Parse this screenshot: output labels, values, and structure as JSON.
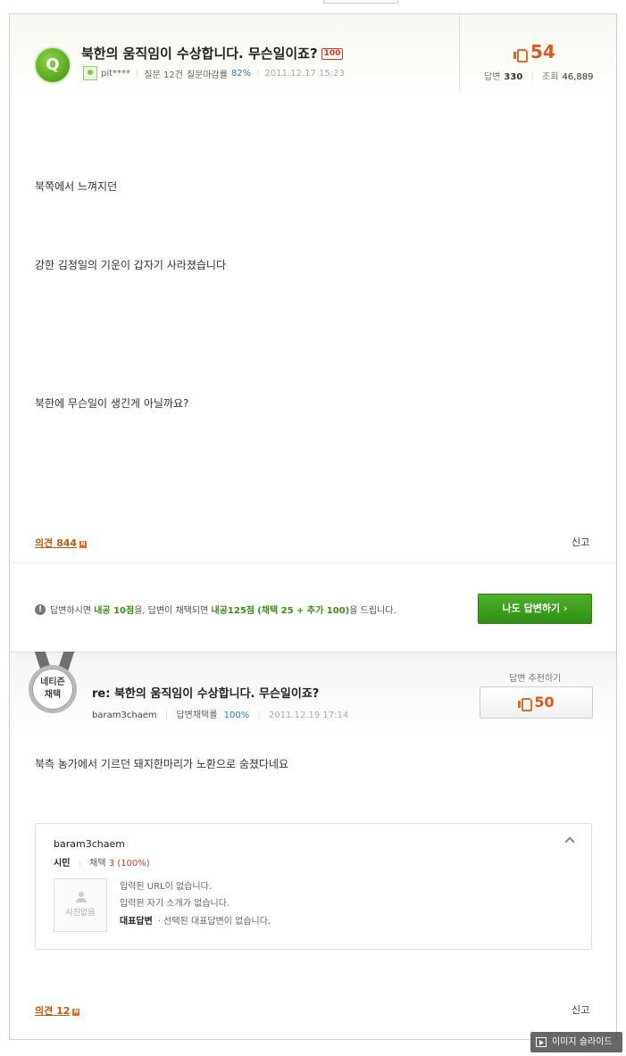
{
  "question": {
    "badge": "Q",
    "title": "북한의 움직임이 수상합니다. 무슨일이죠?",
    "bounty_tag": "100",
    "author": "pit****",
    "questions_label": "질문 12건",
    "close_rate_label": "질문마감률",
    "close_rate": "82%",
    "datetime": "2011.12.17 15:23",
    "likes": "54",
    "answers_label": "답변",
    "answers_count": "330",
    "views_label": "조회",
    "views_count": "46,889",
    "body_lines": [
      "북쪽에서 느껴지던",
      "강한 김정일의 기운이 갑자기 사라졌습니다",
      "북한에 무슨일이 생긴게 아닐까요?"
    ],
    "opinion_label": "의견",
    "opinion_count": "844",
    "report_label": "신고"
  },
  "notice": {
    "part1": "답변하시면",
    "part2": "내공 10점",
    "part3": "을, 답변이 채택되면",
    "part4": "내공125점",
    "part5": "(채택 25 + 추가 100)",
    "part6": "을 드립니다.",
    "answer_button": "나도 답변하기 ›"
  },
  "answer": {
    "medal_line1": "네티즌",
    "medal_line2": "채택",
    "title": "re: 북한의 움직임이 수상합니다. 무슨일이죠?",
    "author": "baram3chaem",
    "adopt_label": "답변채택률",
    "adopt_rate": "100%",
    "datetime": "2011.12.19 17:14",
    "recommend_label": "답변 추천하기",
    "recommend_count": "50",
    "body": "북측 농가에서 기르던 돼지한마리가 노환으로 숨졌다네요",
    "profile": {
      "name": "baram3chaem",
      "level": "시민",
      "adopt_label": "채택",
      "adopt_value": "3 (100%)",
      "photo_text": "사진없음",
      "url_line": "입력된 URL이 없습니다.",
      "intro_line": "입력된 자기 소개가 없습니다.",
      "rep_label": "대표답변",
      "rep_value": "· 선택된 대표답변이 없습니다."
    },
    "opinion_label": "의견",
    "opinion_count": "12",
    "report_label": "신고"
  },
  "slide_button": "이미지 슬라이드",
  "colors": {
    "accent_orange": "#e2541c",
    "green": "#3b8d17",
    "link_blue": "#3a79b8"
  }
}
